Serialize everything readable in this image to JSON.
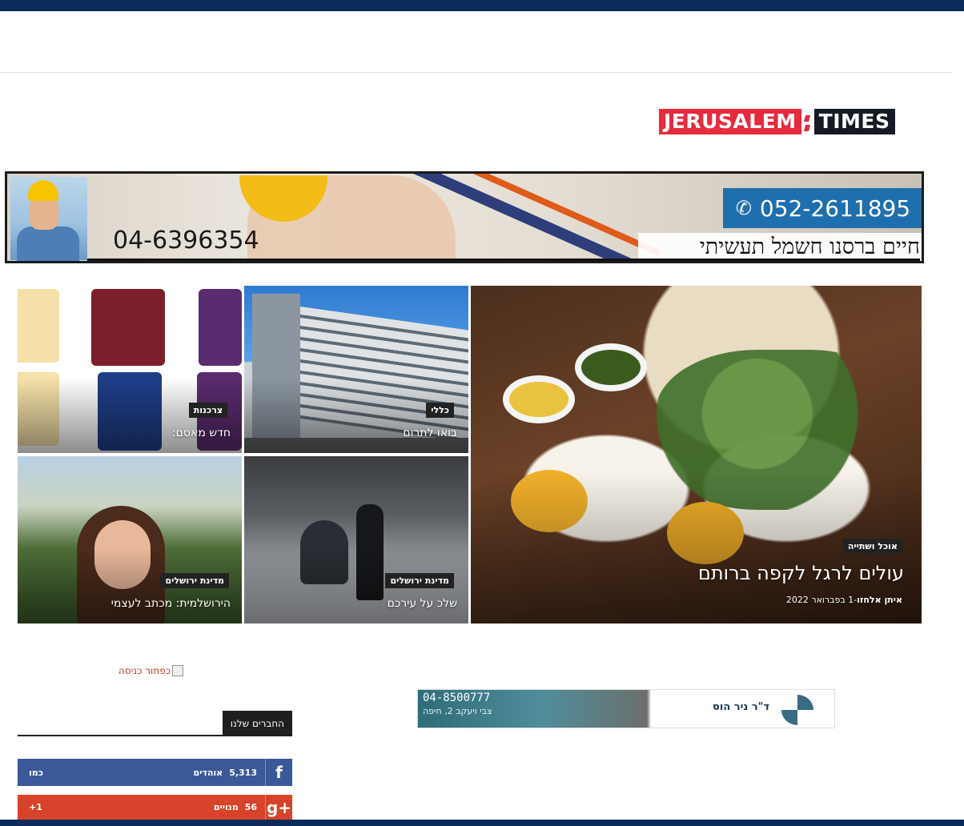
{
  "header": {
    "logo_part1": "JERUSALEM",
    "logo_part2": "TIMES"
  },
  "ad_banner": {
    "phone_left": "04-6396354",
    "phone_right": "052-2611895",
    "slogan": "חיים ברסנו חשמל תעשיתי"
  },
  "featured": {
    "main": {
      "category": "אוכל ושתייה",
      "title": "עולים לרגל לקפה ברותם",
      "author": "איתן אלחזו",
      "date": "1 בפברואר 2022",
      "meta_sep": " - "
    },
    "tiles": [
      {
        "category": "כללי",
        "title": "בואו לתרום"
      },
      {
        "category": "צרכנות",
        "title": "חדש מאסם:"
      },
      {
        "category": "מדינת ירושלים",
        "title": "שלכ על עירכם"
      },
      {
        "category": "מדינת ירושלים",
        "title": "הירושלמית: מכתב לעצמי"
      }
    ]
  },
  "sidebar": {
    "entry_button_alt": "כפתור כניסה",
    "friends_title": "החברים שלנו",
    "facebook": {
      "count": "5,313",
      "unit": "אוהדים",
      "action": "כמו"
    },
    "google": {
      "count": "56",
      "unit": "מנויים",
      "action": "1+"
    }
  },
  "doctor_ad": {
    "phone": "04-8500777",
    "address": "צבי ויעקב 2, חיפה",
    "name": "ד\"ר ניר הוס"
  },
  "colors": {
    "top_bar": "#0b2a5c",
    "logo_red": "#e52b3d",
    "facebook": "#3b5998",
    "google_plus": "#d7432a"
  }
}
